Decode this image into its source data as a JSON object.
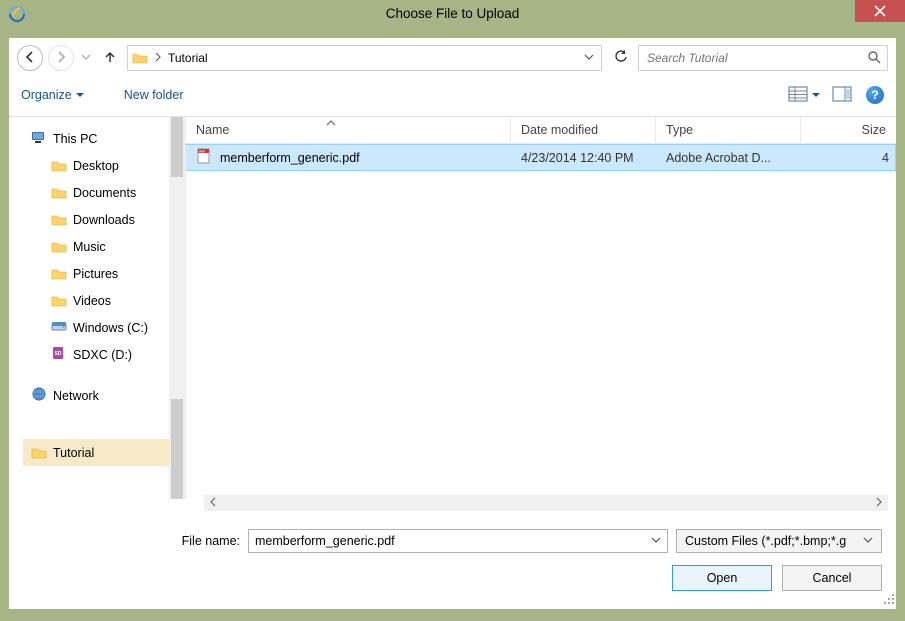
{
  "window": {
    "title": "Choose File to Upload"
  },
  "address": {
    "folder": "Tutorial"
  },
  "search": {
    "placeholder": "Search Tutorial"
  },
  "toolbar": {
    "organize": "Organize",
    "new_folder": "New folder"
  },
  "help": {
    "glyph": "?"
  },
  "tree": {
    "this_pc": "This PC",
    "desktop": "Desktop",
    "documents": "Documents",
    "downloads": "Downloads",
    "music": "Music",
    "pictures": "Pictures",
    "videos": "Videos",
    "drive_c": "Windows (C:)",
    "drive_d": "SDXC (D:)",
    "network": "Network",
    "tutorial": "Tutorial"
  },
  "headers": {
    "name": "Name",
    "date": "Date modified",
    "type": "Type",
    "size": "Size"
  },
  "files": [
    {
      "name": "memberform_generic.pdf",
      "date": "4/23/2014 12:40 PM",
      "type": "Adobe Acrobat D...",
      "size": "4"
    }
  ],
  "filename": {
    "label": "File name:",
    "value": "memberform_generic.pdf"
  },
  "filter": {
    "text": "Custom Files (*.pdf;*.bmp;*.g"
  },
  "buttons": {
    "open": "Open",
    "cancel": "Cancel"
  }
}
